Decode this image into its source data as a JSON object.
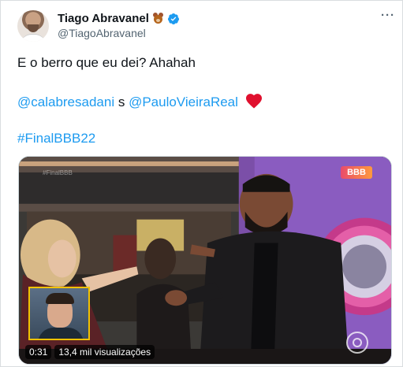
{
  "author": {
    "display_name": "Tiago Abravanel",
    "handle": "@TiagoAbravanel",
    "name_emoji": "teddy-bear-icon",
    "verified": true
  },
  "tweet": {
    "line1": "E o berro que eu dei? Ahahah",
    "mention1": "@calabresadani",
    "connector": " s ",
    "mention2": "@PauloVieiraReal",
    "line2_emoji": "red-heart-icon",
    "hashtag": "#FinalBBB22"
  },
  "media": {
    "type": "video",
    "duration": "0:31",
    "views": "13,4 mil visualizações",
    "logo_text": "BBB",
    "watermark": "#FinalBBB"
  },
  "colors": {
    "link": "#1d9bf0",
    "text": "#0f1419",
    "secondary": "#536471",
    "heart": "#f91880"
  }
}
